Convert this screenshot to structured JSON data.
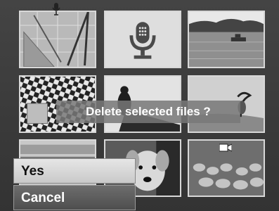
{
  "dialog": {
    "message": "Delete selected files ?",
    "yes_label": "Yes",
    "cancel_label": "Cancel"
  },
  "thumbnails": [
    {
      "kind": "photo",
      "subject": "drafting-tools"
    },
    {
      "kind": "voice-memo",
      "icon": "microphone-icon"
    },
    {
      "kind": "photo",
      "subject": "lake-boat"
    },
    {
      "kind": "photo",
      "subject": "checkered-floor"
    },
    {
      "kind": "photo",
      "subject": "bird-silhouette"
    },
    {
      "kind": "photo",
      "subject": "heron"
    },
    {
      "kind": "photo",
      "subject": "window-sill"
    },
    {
      "kind": "photo",
      "subject": "dog"
    },
    {
      "kind": "video",
      "subject": "sheep-flock"
    }
  ],
  "colors": {
    "background": "#3a3a3a",
    "selected_button": "#d6d6d6",
    "unselected_button": "#5c5c5c",
    "thumb_border": "#d8d8d8"
  }
}
